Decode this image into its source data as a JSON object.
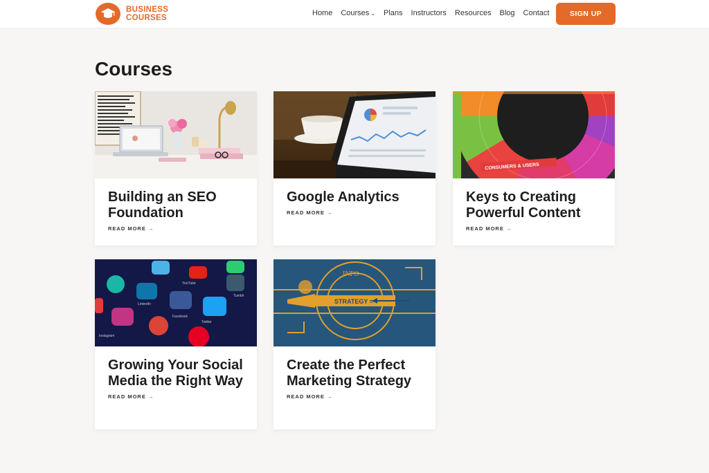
{
  "brand": {
    "line1": "BUSINESS",
    "line2": "COURSES",
    "accent_color": "#e46a2a",
    "icon": "graduation-cap-icon"
  },
  "nav": {
    "items": [
      "Home",
      "Courses",
      "Plans",
      "Instructors",
      "Resources",
      "Blog",
      "Contact"
    ],
    "courses_chevron": "⌄",
    "signup_label": "SIGN UP"
  },
  "main": {
    "title": "Courses",
    "read_more_label": "READ MORE →",
    "courses": [
      {
        "title": "Building an SEO Foundation",
        "image": "desk-workspace"
      },
      {
        "title": "Google Analytics",
        "image": "tablet-analytics"
      },
      {
        "title": "Keys to Creating Powerful Content",
        "image": "color-wheel"
      },
      {
        "title": "Growing Your Social Media the Right Way",
        "image": "social-app-icons"
      },
      {
        "title": "Create the Perfect Marketing Strategy",
        "image": "strategy-blueprint"
      }
    ]
  }
}
